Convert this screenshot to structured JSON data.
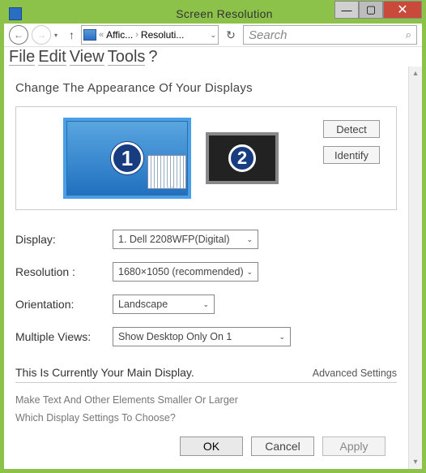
{
  "titlebar": {
    "title": "Screen Resolution"
  },
  "breadcrumb": {
    "seg1": "Affic...",
    "seg2": "Resoluti..."
  },
  "search": {
    "placeholder": "Search"
  },
  "menu": {
    "file": "File",
    "edit": "Edit",
    "view": "View",
    "tools": "Tools",
    "help": "?"
  },
  "heading": "Change The Appearance Of Your Displays",
  "monitors": {
    "m1": "1",
    "m2": "2"
  },
  "buttons": {
    "detect": "Detect",
    "identify": "Identify"
  },
  "form": {
    "display_label": "Display:",
    "display_value": "1. Dell 2208WFP(Digital)",
    "resolution_label": "Resolution :",
    "resolution_value": "1680×1050 (recommended)",
    "orientation_label": "Orientation:",
    "orientation_value": "Landscape",
    "multi_label": "Multiple Views:",
    "multi_value": "Show Desktop Only On 1"
  },
  "main_display_text": "This Is Currently Your Main Display.",
  "advanced": "Advanced Settings",
  "link1": "Make Text And Other Elements Smaller Or Larger",
  "link2": "Which Display Settings To Choose?",
  "footer": {
    "ok": "OK",
    "cancel": "Cancel",
    "apply": "Apply"
  }
}
